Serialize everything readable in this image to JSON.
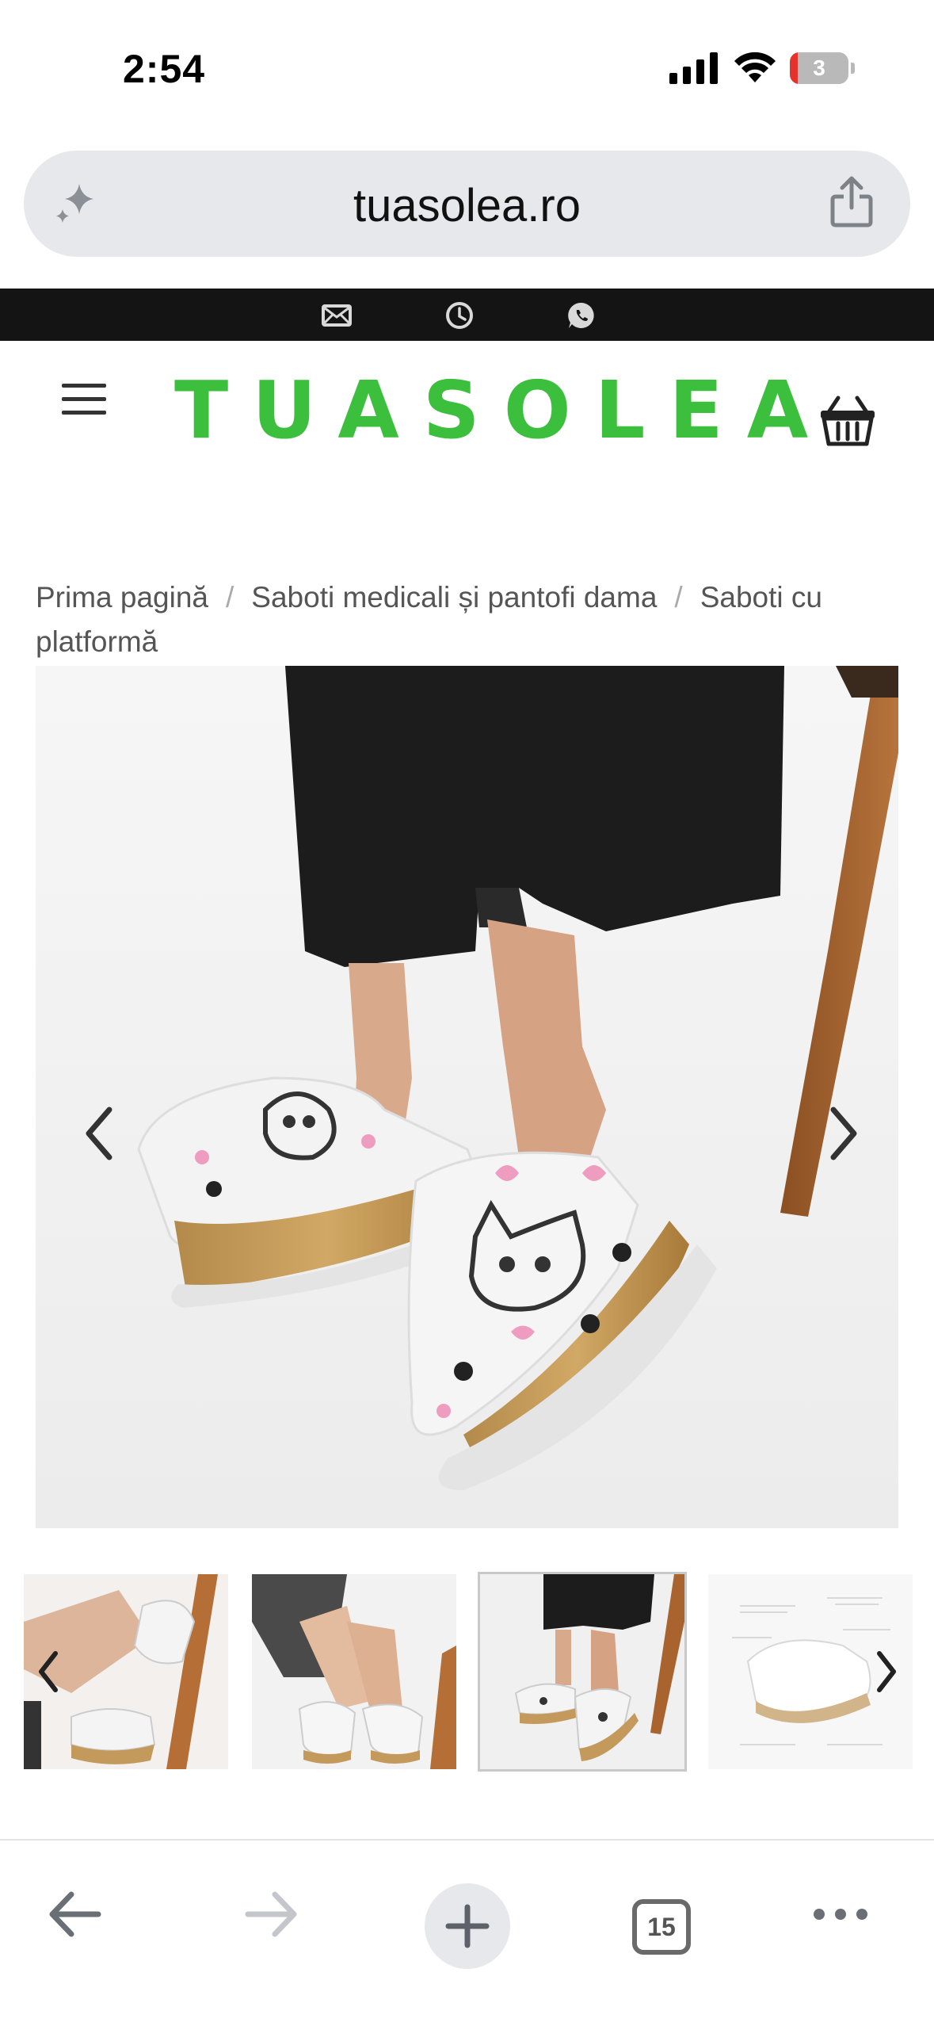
{
  "status_bar": {
    "time": "2:54",
    "battery_level": "3",
    "icons": [
      "cellular-signal-icon",
      "wifi-icon",
      "battery-icon"
    ]
  },
  "browser": {
    "url": "tuasolea.ro",
    "icons": [
      "sparkle-icon",
      "share-icon"
    ]
  },
  "contact_bar": {
    "icons": [
      "envelope-icon",
      "clock-icon",
      "whatsapp-icon"
    ],
    "background": "#141414"
  },
  "header": {
    "logo_text": "TUASOLEA",
    "logo_color": "#3cbf3c",
    "icons": [
      "menu-icon",
      "basket-icon"
    ]
  },
  "breadcrumb": {
    "items": [
      "Prima pagină",
      "Saboti medicali și pantofi dama",
      "Saboti cu platformă"
    ],
    "separator": "/"
  },
  "gallery": {
    "main_image": "photo of white platform clogs with dog print and pink hearts",
    "thumbnails_count": 4,
    "active_thumbnail": 3
  },
  "toolbar": {
    "open_tabs": "15",
    "icons": [
      "back-arrow-icon",
      "forward-arrow-icon",
      "plus-icon",
      "tabs-icon",
      "more-icon"
    ]
  }
}
